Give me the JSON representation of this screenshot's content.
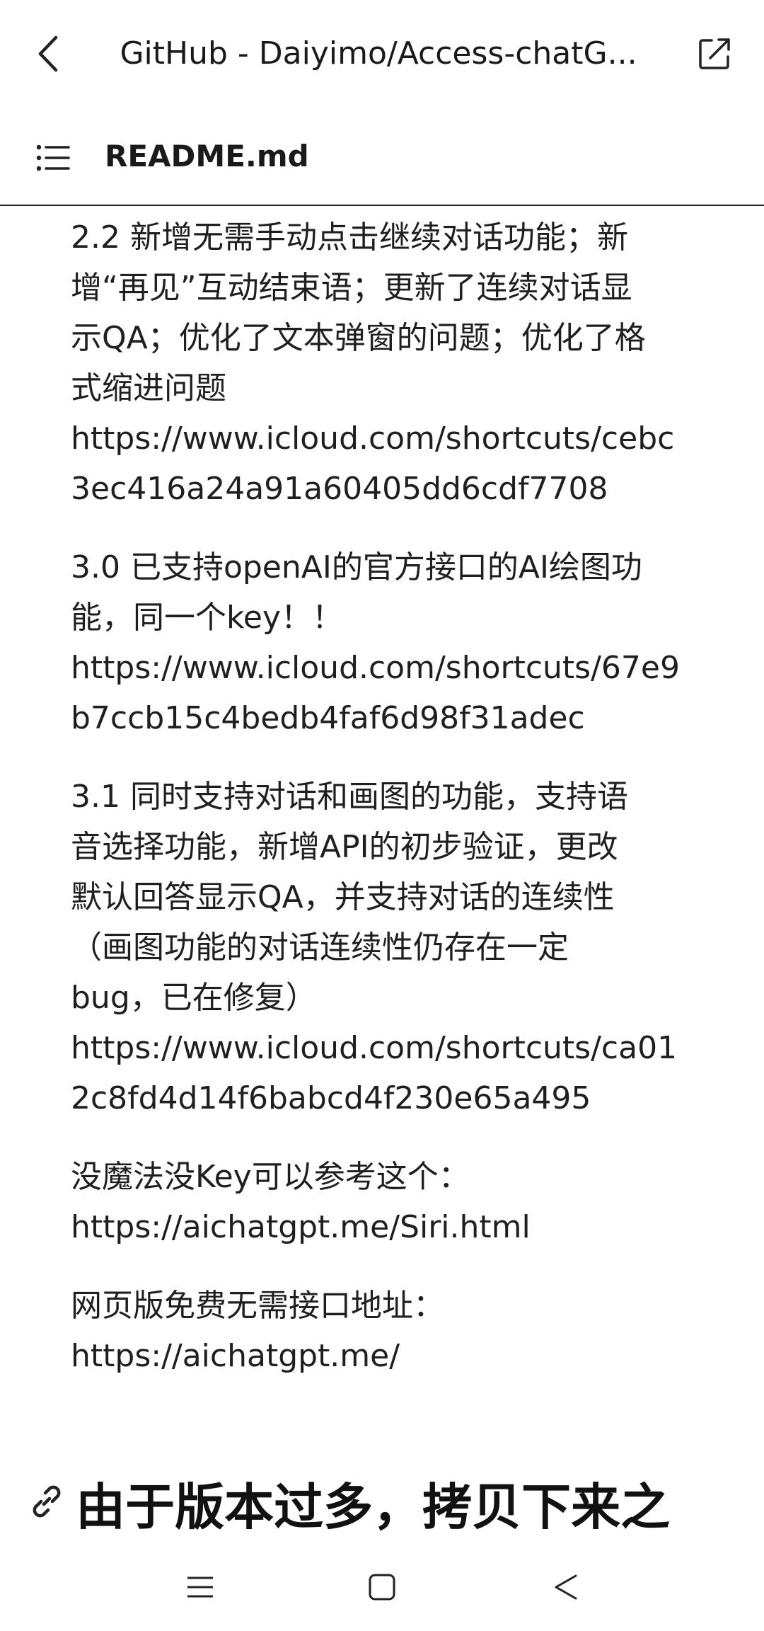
{
  "header": {
    "title": "GitHub - Daiyimo/Access-chatG...",
    "back_icon": "chevron-left-icon",
    "external_icon": "open-external-icon"
  },
  "file": {
    "name": "README.md",
    "toc_icon": "list-icon"
  },
  "content": {
    "paragraphs": [
      {
        "lines": [
          "2.2 新增无需手动点击继续对话功能；新",
          "增“再见”互动结束语；更新了连续对话显",
          "示QA；优化了文本弹窗的问题；优化了格",
          "式缩进问题",
          "https://www.icloud.com/shortcuts/cebc",
          "3ec416a24a91a60405dd6cdf7708"
        ]
      },
      {
        "lines": [
          "3.0 已支持openAI的官方接口的AI绘图功",
          "能，同一个key！！",
          "https://www.icloud.com/shortcuts/67e9",
          "b7ccb15c4bedb4faf6d98f31adec"
        ]
      },
      {
        "lines": [
          "3.1 同时支持对话和画图的功能，支持语",
          "音选择功能，新增API的初步验证，更改",
          "默认回答显示QA，并支持对话的连续性",
          "（画图功能的对话连续性仍存在一定",
          "bug，已在修复）",
          "https://www.icloud.com/shortcuts/ca01",
          "2c8fd4d14f6babcd4f230e65a495"
        ]
      },
      {
        "lines": [
          "没魔法没Key可以参考这个：",
          "https://aichatgpt.me/Siri.html"
        ]
      },
      {
        "lines": [
          "网页版免费无需接口地址：",
          "https://aichatgpt.me/"
        ]
      }
    ],
    "heading": "由于版本过多，拷贝下来之",
    "heading_icon": "link-icon"
  },
  "navbar": {
    "menu_icon": "menu-icon",
    "home_icon": "square-home-icon",
    "back_icon": "triangle-back-icon"
  }
}
